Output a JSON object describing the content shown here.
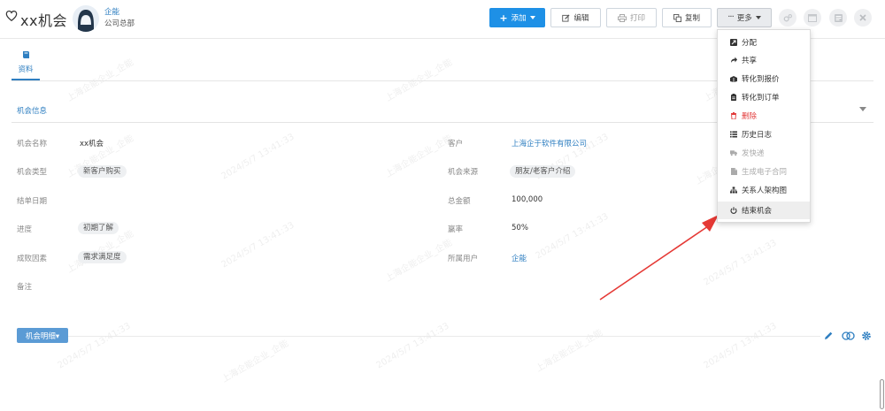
{
  "header": {
    "title": "xx机会",
    "owner_name": "企能",
    "owner_dept": "公司总部"
  },
  "toolbar": {
    "add_label": "添加",
    "edit_label": "编辑",
    "print_label": "打印",
    "copy_label": "复制",
    "more_label": "更多"
  },
  "tabs": [
    {
      "label": "资料"
    }
  ],
  "section": {
    "title": "机会信息"
  },
  "fields": {
    "name": {
      "label": "机会名称",
      "value": "xx机会"
    },
    "type": {
      "label": "机会类型",
      "value": "新客户购买"
    },
    "close_date": {
      "label": "结单日期",
      "value": ""
    },
    "stage": {
      "label": "进度",
      "value": "初期了解"
    },
    "reason": {
      "label": "成败因素",
      "value": "需求满足度"
    },
    "note": {
      "label": "备注",
      "value": ""
    },
    "customer": {
      "label": "客户",
      "value": "上海企于软件有限公司"
    },
    "source": {
      "label": "机会来源",
      "value": "朋友/老客户介绍"
    },
    "amount": {
      "label": "总金额",
      "value": "100,000"
    },
    "win_rate": {
      "label": "赢率",
      "value": "50%"
    },
    "owner": {
      "label": "所属用户",
      "value": "企能"
    }
  },
  "details": {
    "button_label": "机会明细▾"
  },
  "more_menu": {
    "items": [
      {
        "label": "分配",
        "icon": "assign-icon",
        "state": "normal"
      },
      {
        "label": "共享",
        "icon": "share-icon",
        "state": "normal"
      },
      {
        "label": "转化到报价",
        "icon": "quote-icon",
        "state": "normal"
      },
      {
        "label": "转化到订单",
        "icon": "order-icon",
        "state": "normal"
      },
      {
        "label": "删除",
        "icon": "trash-icon",
        "state": "danger"
      },
      {
        "label": "历史日志",
        "icon": "list-icon",
        "state": "normal"
      },
      {
        "label": "发快递",
        "icon": "truck-icon",
        "state": "muted"
      },
      {
        "label": "生成电子合同",
        "icon": "file-icon",
        "state": "muted"
      },
      {
        "label": "关系人架构图",
        "icon": "sitemap-icon",
        "state": "normal"
      },
      {
        "label": "结束机会",
        "icon": "power-icon",
        "state": "hover"
      }
    ]
  },
  "watermark": {
    "company": "上海企能企业_企能",
    "timestamp": "2024/5/7 13:41:33"
  },
  "colors": {
    "primary": "#1e90e6",
    "link": "#2f7fc1",
    "danger": "#e23b3b",
    "annotation_arrow": "#e53935"
  }
}
